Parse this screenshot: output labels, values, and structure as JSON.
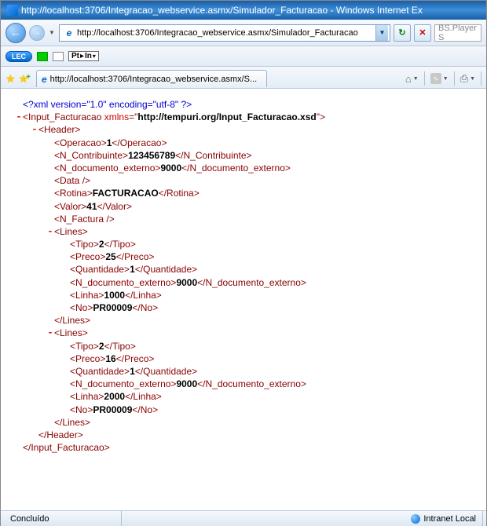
{
  "window": {
    "title": "http://localhost:3706/Integracao_webservice.asmx/Simulador_Facturacao - Windows Internet Ex"
  },
  "address": {
    "url": "http://localhost:3706/Integracao_webservice.asmx/Simulador_Facturacao"
  },
  "search": {
    "placeholder": "BS.Player S"
  },
  "toolbar": {
    "lec": "LEC",
    "lang_from": "Pt",
    "lang_to": "In"
  },
  "tab": {
    "label": "http://localhost:3706/Integracao_webservice.asmx/S..."
  },
  "xml": {
    "pi": "<?xml version=\"1.0\" encoding=\"utf-8\" ?>",
    "root": "Input_Facturacao",
    "xmlns": "http://tempuri.org/Input_Facturacao.xsd",
    "header": {
      "Operacao": "1",
      "N_Contribuinte": "123456789",
      "N_documento_externo": "9000",
      "Rotina": "FACTURACAO",
      "Valor": "41"
    },
    "lines": [
      {
        "Tipo": "2",
        "Preco": "25",
        "Quantidade": "1",
        "N_documento_externo": "9000",
        "Linha": "1000",
        "No": "PR00009"
      },
      {
        "Tipo": "2",
        "Preco": "16",
        "Quantidade": "1",
        "N_documento_externo": "9000",
        "Linha": "2000",
        "No": "PR00009"
      }
    ]
  },
  "status": {
    "left": "Concluído",
    "zone": "Intranet Local"
  }
}
